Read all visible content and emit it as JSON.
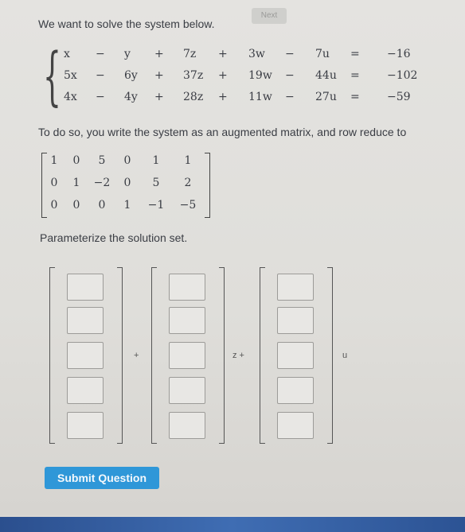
{
  "header": {
    "next_label": "Next"
  },
  "intro_text": "We want to solve the system below.",
  "system": {
    "rows": [
      [
        "x",
        "−",
        "y",
        "+",
        "7z",
        "+",
        "3w",
        "−",
        "7u",
        "=",
        "−16"
      ],
      [
        "5x",
        "−",
        "6y",
        "+",
        "37z",
        "+",
        "19w",
        "−",
        "44u",
        "=",
        "−102"
      ],
      [
        "4x",
        "−",
        "4y",
        "+",
        "28z",
        "+",
        "11w",
        "−",
        "27u",
        "=",
        "−59"
      ]
    ]
  },
  "reduce_text": "To do so, you write the system as an augmented matrix, and row reduce to",
  "rref": {
    "rows": [
      [
        "1",
        "0",
        "5",
        "0",
        "1",
        "1"
      ],
      [
        "0",
        "1",
        "−2",
        "0",
        "5",
        "2"
      ],
      [
        "0",
        "0",
        "0",
        "1",
        "−1",
        "−5"
      ]
    ]
  },
  "parameterize_text": "Parameterize the solution set.",
  "vectors": {
    "plus_label": "+",
    "z_label": "z +",
    "u_label": "u",
    "entries": [
      [
        "",
        "",
        "",
        "",
        ""
      ],
      [
        "",
        "",
        "",
        "",
        ""
      ],
      [
        "",
        "",
        "",
        "",
        ""
      ]
    ]
  },
  "submit_label": "Submit Question"
}
